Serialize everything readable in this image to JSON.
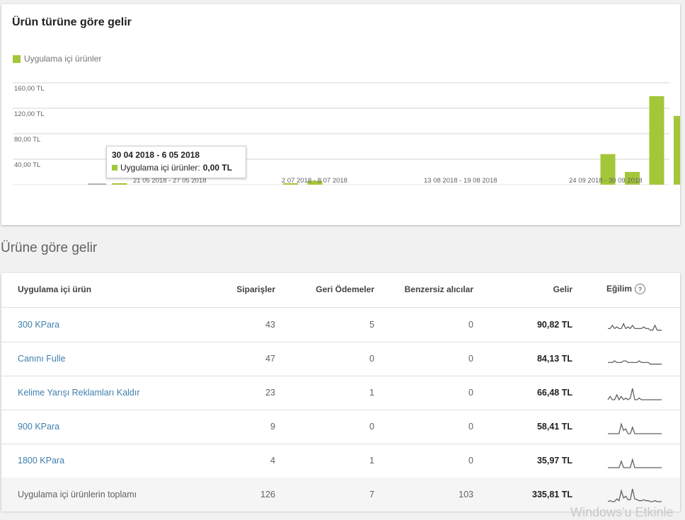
{
  "chart_card": {
    "title": "Ürün türüne göre gelir",
    "legend_label": "Uygulama içi ürünler"
  },
  "chart_data": {
    "type": "bar",
    "title": "Ürün türüne göre gelir",
    "series": [
      {
        "name": "Uygulama içi ürünler",
        "color": "#a4c639"
      }
    ],
    "y_ticks": [
      "160,00 TL",
      "120,00 TL",
      "80,00 TL",
      "40,00 TL"
    ],
    "ylim": [
      0,
      160
    ],
    "x_labels": [
      "21 05 2018 - 27 05 2018",
      "2 07 2018 - 8 07 2018",
      "13 08 2018 - 19 08 2018",
      "24 09 2018 - 30 09 2018"
    ],
    "bars": [
      {
        "index": 0,
        "value": 0.0
      },
      {
        "index": 1,
        "value": 0.4
      },
      {
        "index": 2,
        "value": 0.0
      },
      {
        "index": 3,
        "value": 0.0
      },
      {
        "index": 4,
        "value": 0.0
      },
      {
        "index": 5,
        "value": 0.0
      },
      {
        "index": 6,
        "value": 0.0
      },
      {
        "index": 7,
        "value": 0.0
      },
      {
        "index": 8,
        "value": 1.2
      },
      {
        "index": 9,
        "value": 6.0
      },
      {
        "index": 10,
        "value": 0.0
      },
      {
        "index": 11,
        "value": 0.0
      },
      {
        "index": 12,
        "value": 0.0
      },
      {
        "index": 13,
        "value": 0.0
      },
      {
        "index": 14,
        "value": 0.0
      },
      {
        "index": 15,
        "value": 0.0
      },
      {
        "index": 16,
        "value": 0.0
      },
      {
        "index": 17,
        "value": 0.0
      },
      {
        "index": 18,
        "value": 0.0
      },
      {
        "index": 19,
        "value": 0.0
      },
      {
        "index": 20,
        "value": 0.0
      },
      {
        "index": 21,
        "value": 48.0
      },
      {
        "index": 22,
        "value": 20.0
      },
      {
        "index": 23,
        "value": 139.0
      },
      {
        "index": 24,
        "value": 108.0
      },
      {
        "index": 25,
        "value": 2.5
      }
    ],
    "grid": true,
    "tooltip": {
      "title": "30 04 2018 - 6 05 2018",
      "label": "Uygulama içi ürünler:",
      "value": "0,00 TL"
    }
  },
  "section_title": "Ürüne göre gelir",
  "table": {
    "headers": {
      "product": "Uygulama içi ürün",
      "orders": "Siparişler",
      "refunds": "Geri Ödemeler",
      "unique_buyers": "Benzersiz alıcılar",
      "revenue": "Gelir",
      "trend": "Eğilim"
    },
    "help_icon": "question-circle-icon",
    "rows": [
      {
        "product": "300 KPara",
        "orders": "43",
        "refunds": "5",
        "unique_buyers": "0",
        "revenue": "90,82 TL",
        "trend": [
          2,
          2,
          4,
          2,
          3,
          2,
          2,
          5,
          2,
          3,
          2,
          4,
          2,
          2,
          2,
          2,
          3,
          2,
          2,
          1,
          1,
          4,
          1,
          1,
          1
        ]
      },
      {
        "product": "Canını Fulle",
        "orders": "47",
        "refunds": "0",
        "unique_buyers": "0",
        "revenue": "84,13 TL",
        "trend": [
          2,
          2,
          2,
          3,
          2,
          2,
          2,
          3,
          3,
          2,
          2,
          2,
          2,
          2,
          3,
          2,
          2,
          2,
          2,
          1,
          1,
          1,
          1,
          1,
          1
        ]
      },
      {
        "product": "Kelime Yarışı Reklamları Kaldır",
        "orders": "23",
        "refunds": "1",
        "unique_buyers": "0",
        "revenue": "66,48 TL",
        "trend": [
          0,
          2,
          0,
          0,
          3,
          0,
          2,
          0,
          1,
          0,
          1,
          7,
          0,
          0,
          1,
          0,
          0,
          0,
          0,
          0,
          0,
          0,
          0,
          0,
          0
        ]
      },
      {
        "product": "900 KPara",
        "orders": "9",
        "refunds": "0",
        "unique_buyers": "0",
        "revenue": "58,41 TL",
        "trend": [
          0,
          0,
          0,
          0,
          0,
          0,
          6,
          2,
          3,
          0,
          0,
          4,
          0,
          0,
          0,
          0,
          0,
          0,
          0,
          0,
          0,
          0,
          0,
          0,
          0
        ]
      },
      {
        "product": "1800 KPara",
        "orders": "4",
        "refunds": "1",
        "unique_buyers": "0",
        "revenue": "35,97 TL",
        "trend": [
          0,
          0,
          0,
          0,
          0,
          0,
          4,
          0,
          0,
          0,
          0,
          5,
          0,
          0,
          0,
          0,
          0,
          0,
          0,
          0,
          0,
          0,
          0,
          0,
          0
        ]
      }
    ],
    "total": {
      "product": "Uygulama içi ürünlerin toplamı",
      "orders": "126",
      "refunds": "7",
      "unique_buyers": "103",
      "revenue": "335,81 TL",
      "trend": [
        0,
        1,
        0,
        0,
        3,
        1,
        12,
        4,
        6,
        2,
        2,
        14,
        3,
        2,
        1,
        1,
        2,
        1,
        1,
        0,
        0,
        1,
        0,
        0,
        0
      ]
    }
  },
  "watermark": "Windows'u Etkinle"
}
